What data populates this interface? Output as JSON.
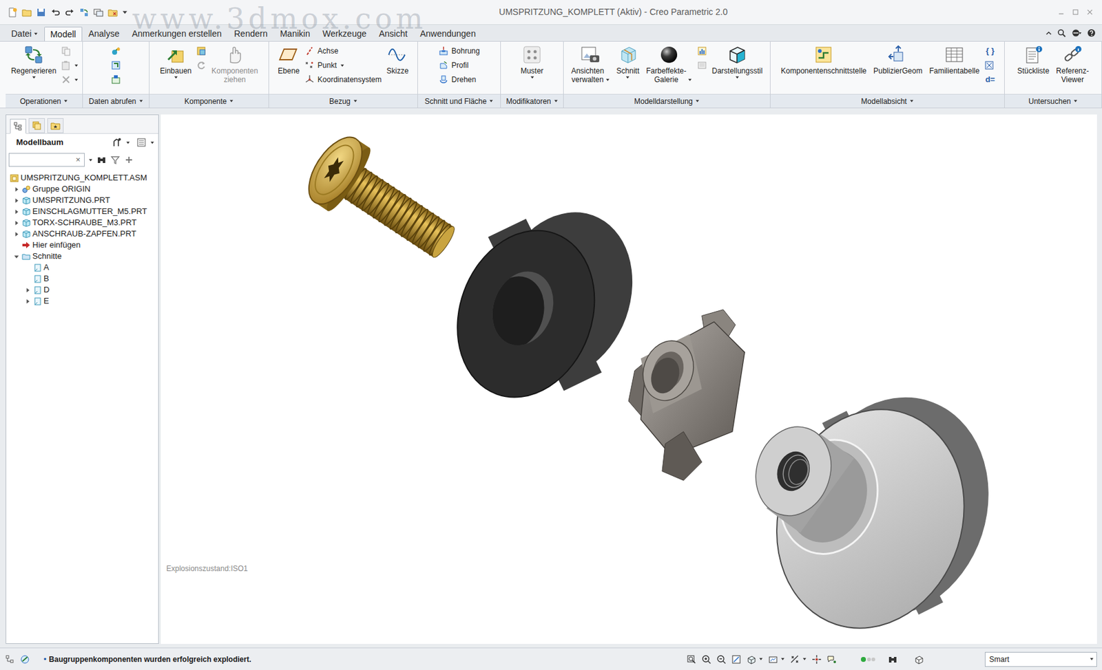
{
  "window": {
    "title": "UMSPRITZUNG_KOMPLETT (Aktiv) - Creo Parametric 2.0",
    "watermark": "www.3dmox.com"
  },
  "menu_tabs": [
    {
      "label": "Datei",
      "selected": false,
      "menu": true
    },
    {
      "label": "Modell",
      "selected": true,
      "menu": false
    },
    {
      "label": "Analyse",
      "selected": false,
      "menu": false
    },
    {
      "label": "Anmerkungen erstellen",
      "selected": false,
      "menu": false
    },
    {
      "label": "Rendern",
      "selected": false,
      "menu": false
    },
    {
      "label": "Manikin",
      "selected": false,
      "menu": false
    },
    {
      "label": "Werkzeuge",
      "selected": false,
      "menu": false
    },
    {
      "label": "Ansicht",
      "selected": false,
      "menu": false
    },
    {
      "label": "Anwendungen",
      "selected": false,
      "menu": false
    }
  ],
  "ribbon": {
    "groups": [
      {
        "label": "Operationen",
        "menu": true,
        "items": [
          {
            "kind": "large",
            "label": "Regenerieren",
            "menu": true,
            "disabled": false
          },
          {
            "kind": "column",
            "entries": [
              {
                "menu": false,
                "disabled": true
              },
              {
                "menu": true,
                "disabled": true
              },
              {
                "menu": true,
                "disabled": true
              }
            ]
          }
        ]
      },
      {
        "label": "Daten abrufen",
        "menu": true,
        "items": [
          {
            "kind": "column",
            "entries": [
              {
                "menu": false,
                "disabled": false
              },
              {
                "menu": false,
                "disabled": false
              },
              {
                "menu": false,
                "disabled": false
              }
            ]
          }
        ]
      },
      {
        "label": "Komponente",
        "menu": true,
        "items": [
          {
            "kind": "large",
            "label": "Einbauen",
            "menu": true,
            "disabled": false
          },
          {
            "kind": "column",
            "entries": [
              {
                "menu": false,
                "disabled": false
              },
              {
                "menu": false,
                "disabled": true
              }
            ]
          },
          {
            "kind": "large",
            "label": "Komponenten\nziehen",
            "menu": false,
            "disabled": true
          }
        ]
      },
      {
        "label": "Bezug",
        "menu": true,
        "items": [
          {
            "kind": "large",
            "label": "Ebene",
            "menu": false,
            "disabled": false
          },
          {
            "kind": "column",
            "entries": [
              {
                "label": "Achse",
                "menu": false,
                "disabled": false
              },
              {
                "label": "Punkt",
                "menu": true,
                "disabled": false
              },
              {
                "label": "Koordinatensystem",
                "menu": false,
                "disabled": false
              }
            ]
          },
          {
            "kind": "large",
            "label": "Skizze",
            "menu": false,
            "disabled": false
          }
        ]
      },
      {
        "label": "Schnitt und Fläche",
        "menu": true,
        "items": [
          {
            "kind": "column",
            "entries": [
              {
                "label": "Bohrung",
                "menu": false,
                "disabled": false
              },
              {
                "label": "Profil",
                "menu": false,
                "disabled": false
              },
              {
                "label": "Drehen",
                "menu": false,
                "disabled": false
              }
            ]
          }
        ]
      },
      {
        "label": "Modifikatoren",
        "menu": true,
        "items": [
          {
            "kind": "large",
            "label": "Muster",
            "menu": true,
            "disabled": false
          }
        ]
      },
      {
        "label": "Modelldarstellung",
        "menu": true,
        "items": [
          {
            "kind": "large",
            "label": "Ansichten\nverwalten",
            "menu": true,
            "disabled": false
          },
          {
            "kind": "large",
            "label": "Schnitt",
            "menu": true,
            "disabled": false
          },
          {
            "kind": "large",
            "label": "Farbeffekte-\nGalerie",
            "menu": true,
            "disabled": false
          },
          {
            "kind": "column",
            "entries": [
              {
                "menu": false,
                "disabled": false
              },
              {
                "menu": false,
                "disabled": true
              }
            ]
          },
          {
            "kind": "large",
            "label": "Darstellungsstil",
            "menu": true,
            "disabled": false
          }
        ]
      },
      {
        "label": "Modellabsicht",
        "menu": true,
        "items": [
          {
            "kind": "large",
            "label": "Komponentenschnittstelle",
            "menu": false,
            "disabled": false
          },
          {
            "kind": "large",
            "label": "PublizierGeom",
            "menu": false,
            "disabled": false
          },
          {
            "kind": "large",
            "label": "Familientabelle",
            "menu": false,
            "disabled": false
          },
          {
            "kind": "column",
            "entries": [
              {
                "glyph": "{ }",
                "menu": false,
                "disabled": false
              },
              {
                "menu": false,
                "disabled": false
              },
              {
                "glyph": "d=",
                "menu": false,
                "disabled": false
              }
            ]
          }
        ]
      },
      {
        "label": "Untersuchen",
        "menu": true,
        "items": [
          {
            "kind": "large",
            "label": "Stückliste",
            "menu": false,
            "disabled": false
          },
          {
            "kind": "large",
            "label": "Referenz-\nViewer",
            "menu": false,
            "disabled": false
          }
        ]
      }
    ]
  },
  "panel_tabs": [
    {
      "selected": true
    },
    {
      "selected": false
    },
    {
      "selected": false
    }
  ],
  "model_tree": {
    "header": "Modellbaum",
    "clear": "×",
    "items": [
      {
        "label": "UMSPRITZUNG_KOMPLETT.ASM",
        "level": 0,
        "kind": "assembly",
        "expandable": false,
        "expanded": false
      },
      {
        "label": "Gruppe ORIGIN",
        "level": 1,
        "kind": "group",
        "expandable": true,
        "expanded": false
      },
      {
        "label": "UMSPRITZUNG.PRT",
        "level": 1,
        "kind": "part",
        "expandable": true,
        "expanded": false
      },
      {
        "label": "EINSCHLAGMUTTER_M5.PRT",
        "level": 1,
        "kind": "part",
        "expandable": true,
        "expanded": false
      },
      {
        "label": "TORX-SCHRAUBE_M3.PRT",
        "level": 1,
        "kind": "part",
        "expandable": true,
        "expanded": false
      },
      {
        "label": "ANSCHRAUB-ZAPFEN.PRT",
        "level": 1,
        "kind": "part",
        "expandable": true,
        "expanded": false
      },
      {
        "label": "Hier einfügen",
        "level": 1,
        "kind": "insert",
        "expandable": false,
        "expanded": false
      },
      {
        "label": "Schnitte",
        "level": 1,
        "kind": "folder",
        "expandable": true,
        "expanded": true
      },
      {
        "label": "A",
        "level": 2,
        "kind": "section",
        "expandable": false,
        "expanded": false
      },
      {
        "label": "B",
        "level": 2,
        "kind": "section",
        "expandable": false,
        "expanded": false
      },
      {
        "label": "D",
        "level": 2,
        "kind": "section",
        "expandable": true,
        "expanded": false
      },
      {
        "label": "E",
        "level": 2,
        "kind": "section",
        "expandable": true,
        "expanded": false
      }
    ]
  },
  "viewport": {
    "explode_state": "Explosionszustand:ISO1"
  },
  "status_bar": {
    "bullet": "•",
    "message": "Baugruppenkomponenten wurden erfolgreich explodiert.",
    "filter": "Smart"
  }
}
